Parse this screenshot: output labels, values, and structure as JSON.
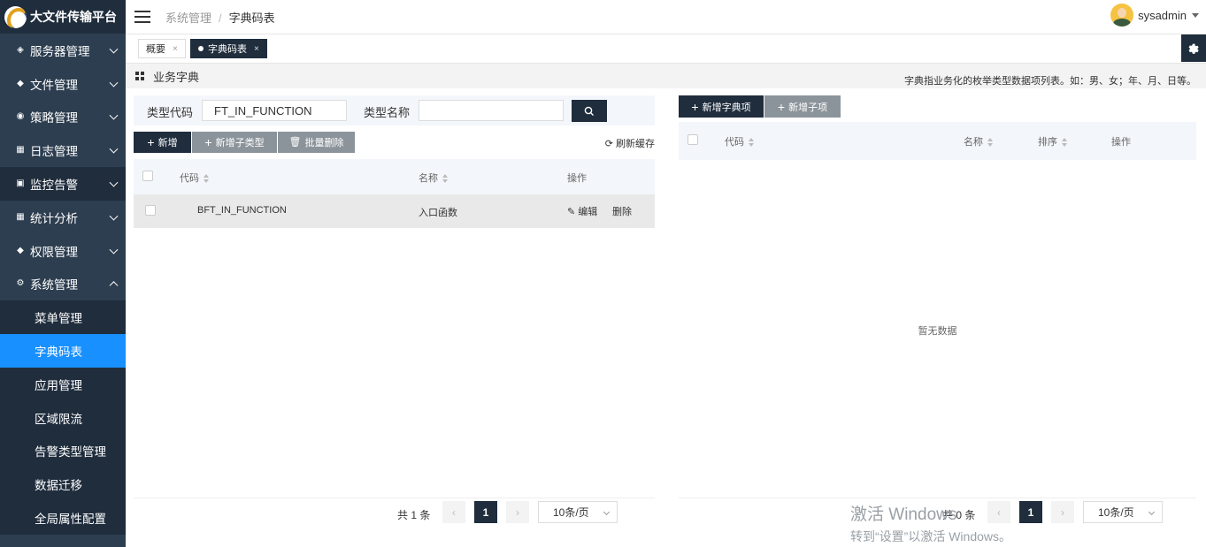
{
  "app": {
    "title": "大文件传输平台",
    "user": "sysadmin"
  },
  "sidebar": {
    "items": [
      {
        "label": "服务器管理",
        "icon": "cube-icon"
      },
      {
        "label": "文件管理",
        "icon": "layers-icon"
      },
      {
        "label": "策略管理",
        "icon": "strategy-icon"
      },
      {
        "label": "日志管理",
        "icon": "log-icon"
      },
      {
        "label": "监控告警",
        "icon": "monitor-icon"
      },
      {
        "label": "统计分析",
        "icon": "chart-icon"
      },
      {
        "label": "权限管理",
        "icon": "permission-icon"
      },
      {
        "label": "系统管理",
        "icon": "gear-icon"
      }
    ],
    "sub_items": [
      "菜单管理",
      "字典码表",
      "应用管理",
      "区域限流",
      "告警类型管理",
      "数据迁移",
      "全局属性配置"
    ]
  },
  "breadcrumb": {
    "parent": "系统管理",
    "separator": "/",
    "current": "字典码表"
  },
  "tabs": [
    {
      "label": "概要",
      "close": "×"
    },
    {
      "label": "字典码表",
      "close": "×"
    }
  ],
  "section": {
    "title": "业务字典",
    "hint": "字典指业务化的枚举类型数据项列表。如：男、女；年、月、日等。"
  },
  "left": {
    "filter": {
      "code_label": "类型代码",
      "code_value": "FT_IN_FUNCTION",
      "name_label": "类型名称",
      "name_value": ""
    },
    "buttons": {
      "add": "新增",
      "add_sub": "新增子类型",
      "batch_delete": "批量删除",
      "refresh": "刷新缓存"
    },
    "columns": {
      "code": "代码",
      "name": "名称",
      "ops": "操作"
    },
    "rows": [
      {
        "code": "BFT_IN_FUNCTION",
        "name": "入口函数",
        "edit": "编辑",
        "delete": "删除"
      }
    ],
    "pager": {
      "total": "共 1 条",
      "current": "1",
      "page_size": "10条/页"
    }
  },
  "right": {
    "buttons": {
      "add_item": "新增字典项",
      "add_sub": "新增子项"
    },
    "columns": {
      "code": "代码",
      "name": "名称",
      "sort": "排序",
      "ops": "操作"
    },
    "empty": "暂无数据",
    "pager": {
      "total": "共 0 条",
      "current": "1",
      "page_size": "10条/页"
    }
  },
  "watermark": {
    "line1": "激活 Windows",
    "line2": "转到“设置”以激活 Windows。"
  }
}
